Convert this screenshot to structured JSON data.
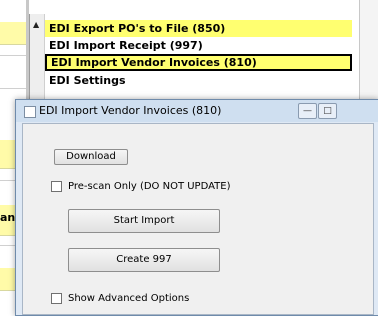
{
  "background": {
    "menu_items": [
      "EDI Export PO's to File (850)",
      "EDI Import Receipt (997)",
      "EDI Import Vendor Invoices (810)",
      "EDI Settings"
    ],
    "scroll_up_glyph": "▲",
    "cut_label": "an"
  },
  "dialog": {
    "title": "EDI Import Vendor Invoices (810)",
    "minimize_glyph": "—",
    "maximize_glyph": "□",
    "download_label": "Download",
    "prescan_label": "Pre-scan Only (DO NOT UPDATE)",
    "start_import_label": "Start Import",
    "create_997_label": "Create 997",
    "advanced_label": "Show Advanced Options"
  }
}
